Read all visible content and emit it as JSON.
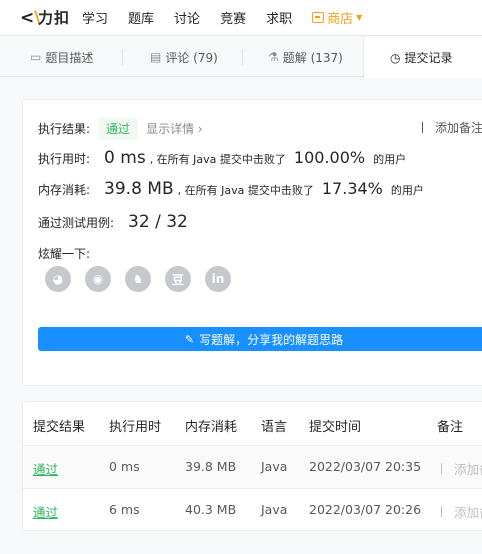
{
  "nav": {
    "logo_text": "力扣",
    "links": [
      "学习",
      "题库",
      "讨论",
      "竞赛",
      "求职"
    ],
    "shop_label": "商店"
  },
  "tabs": [
    {
      "label": "题目描述",
      "icon": "description-icon"
    },
    {
      "label": "评论 (79)",
      "icon": "comment-icon"
    },
    {
      "label": "题解 (137)",
      "icon": "flask-icon"
    },
    {
      "label": "提交记录",
      "icon": "clock-icon"
    }
  ],
  "result": {
    "status_label": "执行结果:",
    "status_value": "通过",
    "show_detail": "显示详情 ›",
    "add_note": "添加备注",
    "runtime_label": "执行用时:",
    "runtime_value": "0 ms",
    "runtime_text": ", 在所有 Java 提交中击败了",
    "runtime_pct": "100.00%",
    "runtime_suffix": "的用户",
    "memory_label": "内存消耗:",
    "memory_value": "39.8 MB",
    "memory_text": ", 在所有 Java 提交中击败了",
    "memory_pct": "17.34%",
    "memory_suffix": "的用户",
    "tests_label": "通过测试用例:",
    "tests_value": "32 / 32",
    "share_label": "炫耀一下:",
    "share_icons": [
      "wechat-icon",
      "weibo-icon",
      "qq-icon",
      "douban-icon",
      "linkedin-icon"
    ],
    "share_glyphs": [
      "◕",
      "◉",
      "♞",
      "豆",
      "in"
    ],
    "solution_button": "写题解，分享我的解题思路"
  },
  "submissions": {
    "headers": [
      "提交结果",
      "执行用时",
      "内存消耗",
      "语言",
      "提交时间",
      "备注"
    ],
    "rows": [
      {
        "status": "通过",
        "runtime": "0 ms",
        "memory": "39.8 MB",
        "lang": "Java",
        "time": "2022/03/07 20:35",
        "note": "添加备注"
      },
      {
        "status": "通过",
        "runtime": "6 ms",
        "memory": "40.3 MB",
        "lang": "Java",
        "time": "2022/03/07 20:26",
        "note": "添加备注"
      }
    ]
  },
  "colors": {
    "accent": "#1890ff",
    "success": "#2db55d",
    "shop": "#f89f1b"
  }
}
